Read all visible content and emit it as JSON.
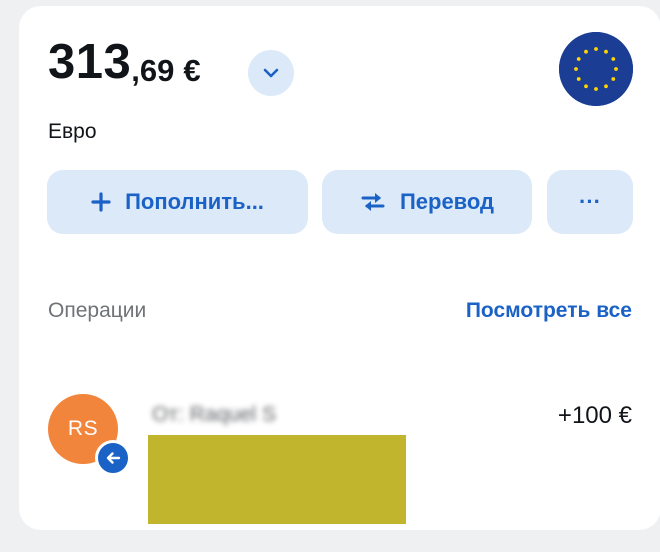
{
  "account": {
    "balance_integer": "313",
    "balance_fraction": ",69",
    "currency_symbol": "€",
    "currency_name": "Евро"
  },
  "actions": {
    "topup_label": "Пополнить...",
    "transfer_label": "Перевод",
    "more_label": "···"
  },
  "operations": {
    "title": "Операции",
    "view_all_label": "Посмотреть все",
    "items": [
      {
        "initials": "RS",
        "name": "От: Raquel S",
        "amount": "+100 €"
      }
    ]
  },
  "colors": {
    "accent": "#1b62c6",
    "button_bg": "#dce9f8",
    "avatar_bg": "#f2853c",
    "flag_bg": "#1b3d94",
    "star": "#ffd400",
    "redaction": "#c1b52d"
  },
  "icons": {
    "dropdown": "chevron-down-icon",
    "flag": "eu-flag-icon",
    "topup": "plus-icon",
    "transfer": "swap-arrows-icon",
    "more": "more-dots-icon",
    "direction": "arrow-left-icon"
  }
}
